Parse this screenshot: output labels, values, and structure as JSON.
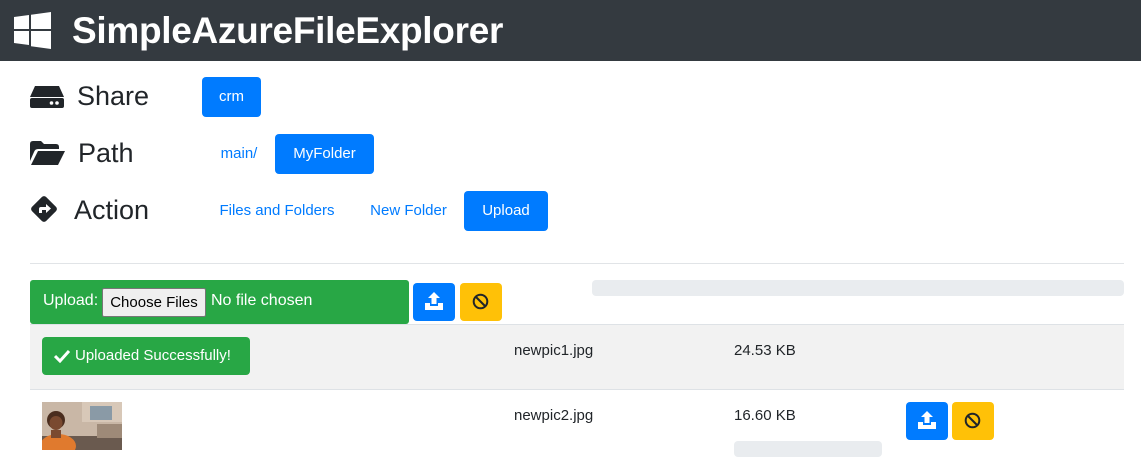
{
  "app": {
    "title": "SimpleAzureFileExplorer"
  },
  "share": {
    "label": "Share",
    "value": "crm"
  },
  "path": {
    "label": "Path",
    "segments": [
      "main/",
      "MyFolder"
    ]
  },
  "action": {
    "label": "Action",
    "items": [
      "Files and Folders",
      "New Folder",
      "Upload"
    ],
    "active": "Upload"
  },
  "upload": {
    "label": "Upload:",
    "choose_files_label": "Choose Files",
    "file_status": "No file chosen",
    "upload_icon": "upload-icon",
    "cancel_icon": "ban-icon"
  },
  "files": [
    {
      "status": "Uploaded Successfully!",
      "name": "newpic1.jpg",
      "size": "24.53 KB"
    },
    {
      "thumbnail": "thumbnail-image",
      "name": "newpic2.jpg",
      "size": "16.60 KB"
    }
  ],
  "colors": {
    "navbar": "#343a40",
    "primary": "#007bff",
    "success": "#28a745",
    "warning": "#ffc107",
    "progress_track": "#e9ecef"
  }
}
